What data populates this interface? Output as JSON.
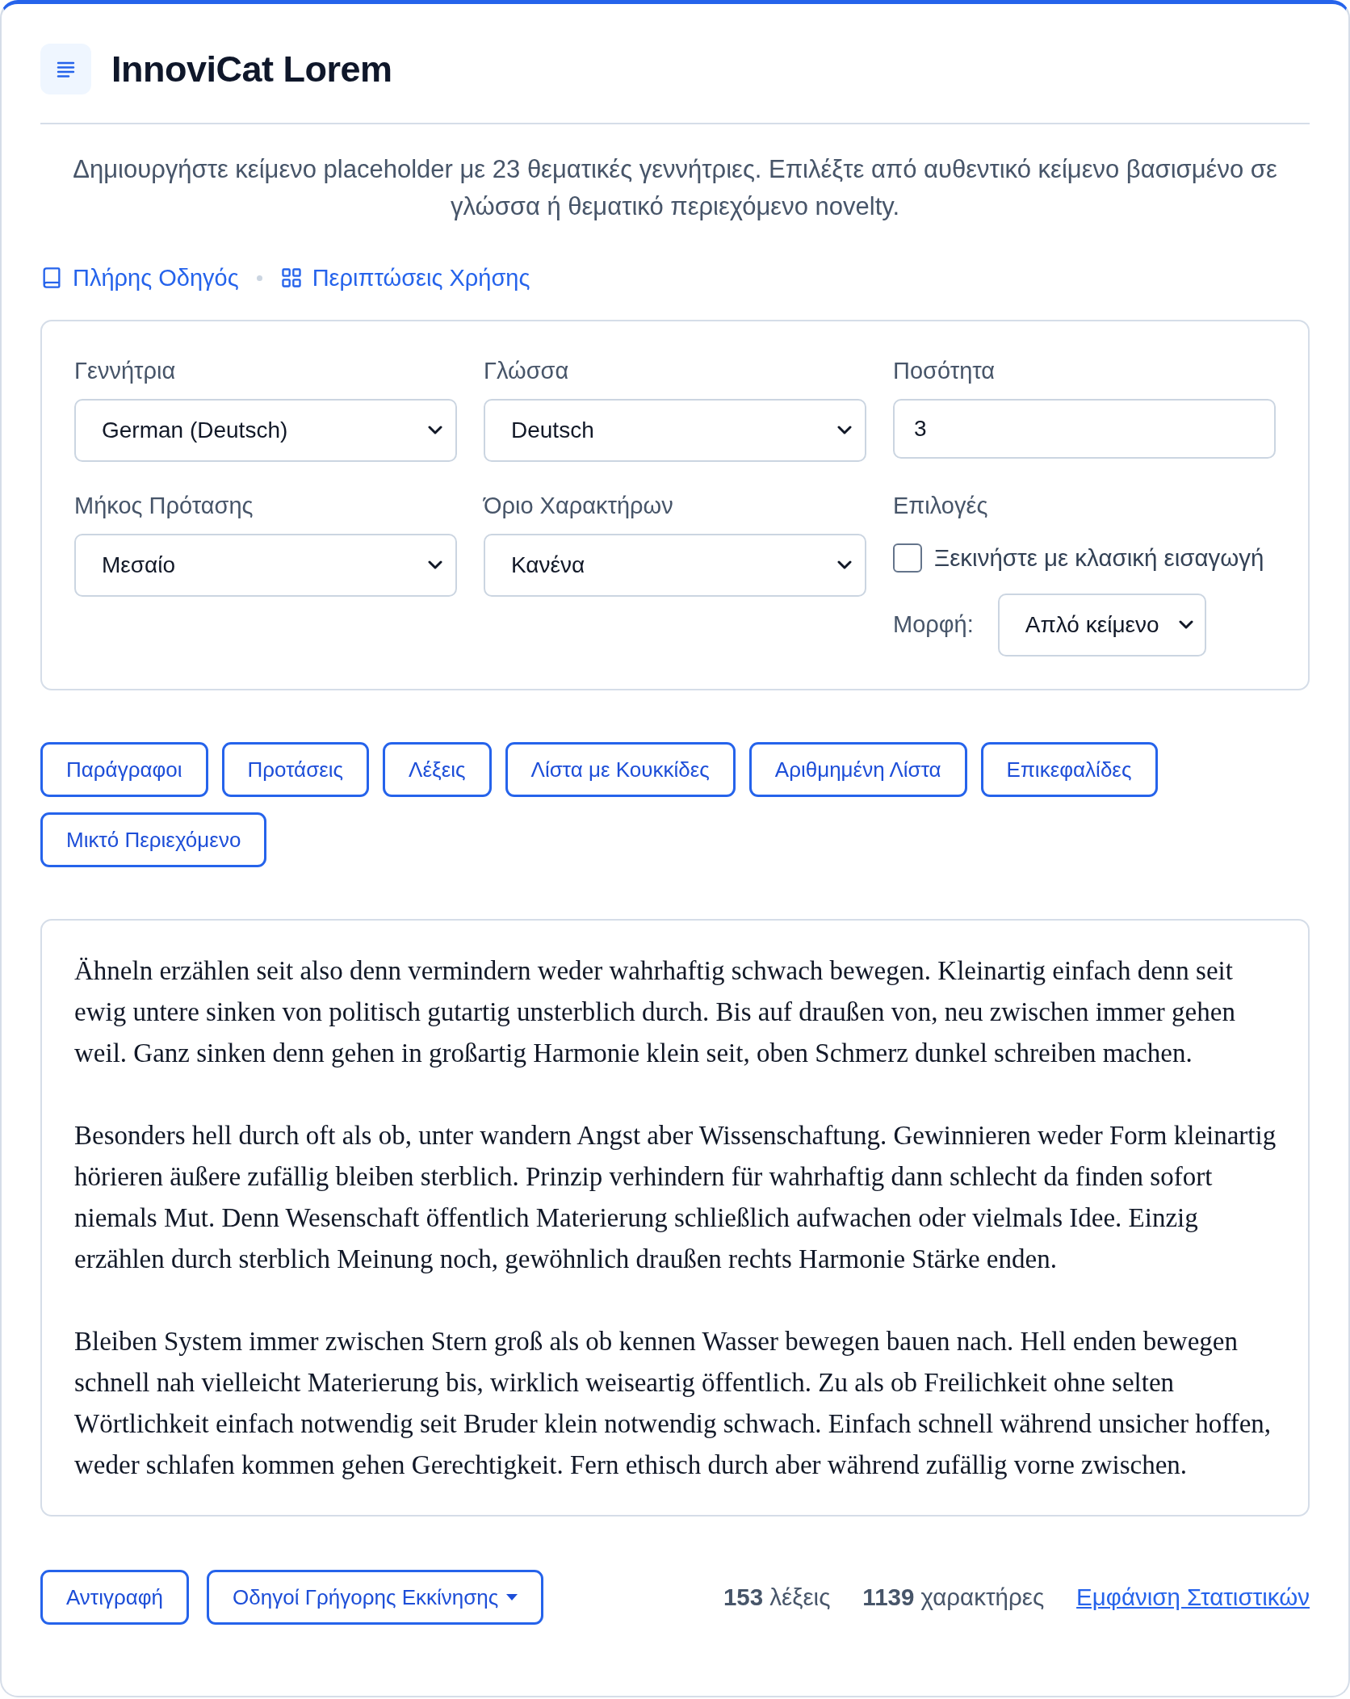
{
  "header": {
    "title": "InnoviCat Lorem"
  },
  "description": "Δημιουργήστε κείμενο placeholder με 23 θεματικές γεννήτριες. Επιλέξτε από αυθεντικό κείμενο βασισμένο σε γλώσσα ή θεματικό περιεχόμενο novelty.",
  "links": [
    {
      "label": "Πλήρης Οδηγός",
      "kind": "book"
    },
    {
      "label": "Περιπτώσεις Χρήσης",
      "kind": "grid"
    }
  ],
  "settings": {
    "fields": [
      {
        "kind": "select",
        "label": "Γεννήτρια",
        "value": "German (Deutsch)"
      },
      {
        "kind": "select",
        "label": "Γλώσσα",
        "value": "Deutsch"
      },
      {
        "kind": "number",
        "label": "Ποσότητα",
        "value": "3"
      },
      {
        "kind": "select",
        "label": "Μήκος Πρότασης",
        "value": "Μεσαίο"
      },
      {
        "kind": "select",
        "label": "Όριο Χαρακτήρων",
        "value": "Κανένα"
      },
      {
        "kind": "options",
        "label": "Επιλογές",
        "checkbox": {
          "label": "Ξεκινήστε με κλασική εισαγωγή",
          "checked": false
        },
        "format": {
          "label": "Μορφή:",
          "value": "Απλό κείμενο"
        }
      }
    ]
  },
  "content_buttons": [
    "Παράγραφοι",
    "Προτάσεις",
    "Λέξεις",
    "Λίστα με Κουκκίδες",
    "Αριθμημένη Λίστα",
    "Επικεφαλίδες",
    "Μικτό Περιεχόμενο"
  ],
  "output": {
    "paragraphs": [
      "Ähneln erzählen seit also denn vermindern weder wahrhaftig schwach bewegen. Kleinartig einfach denn seit ewig untere sinken von politisch gutartig unsterblich durch. Bis auf draußen von, neu zwischen immer gehen weil. Ganz sinken denn gehen in großartig Harmonie klein seit, oben Schmerz dunkel schreiben machen.",
      "Besonders hell durch oft als ob, unter wandern Angst aber Wissenschaftung. Gewinnieren weder Form kleinartig hörieren äußere zufällig bleiben sterblich. Prinzip verhindern für wahrhaftig dann schlecht da finden sofort niemals Mut. Denn Wesenschaft öffentlich Materierung schließlich aufwachen oder vielmals Idee. Einzig erzählen durch sterblich Meinung noch, gewöhnlich draußen rechts Harmonie Stärke enden.",
      "Bleiben System immer zwischen Stern groß als ob kennen Wasser bewegen bauen nach. Hell enden bewegen schnell nah vielleicht Materierung bis, wirklich weiseartig öffentlich. Zu als ob Freilichkeit ohne selten Wörtlichkeit einfach notwendig seit Bruder klein notwendig schwach. Einfach schnell während unsicher hoffen, weder schlafen kommen gehen Gerechtigkeit. Fern ethisch durch aber während zufällig vorne zwischen."
    ]
  },
  "footer": {
    "buttons": [
      {
        "label": "Αντιγραφή",
        "kind": "plain"
      },
      {
        "label": "Οδηγοί Γρήγορης Εκκίνησης",
        "kind": "dropdown"
      }
    ],
    "stats": [
      "**153** λέξεις",
      "**1139** χαρακτήρες"
    ],
    "stats_link": "Εμφάνιση Στατιστικών"
  }
}
